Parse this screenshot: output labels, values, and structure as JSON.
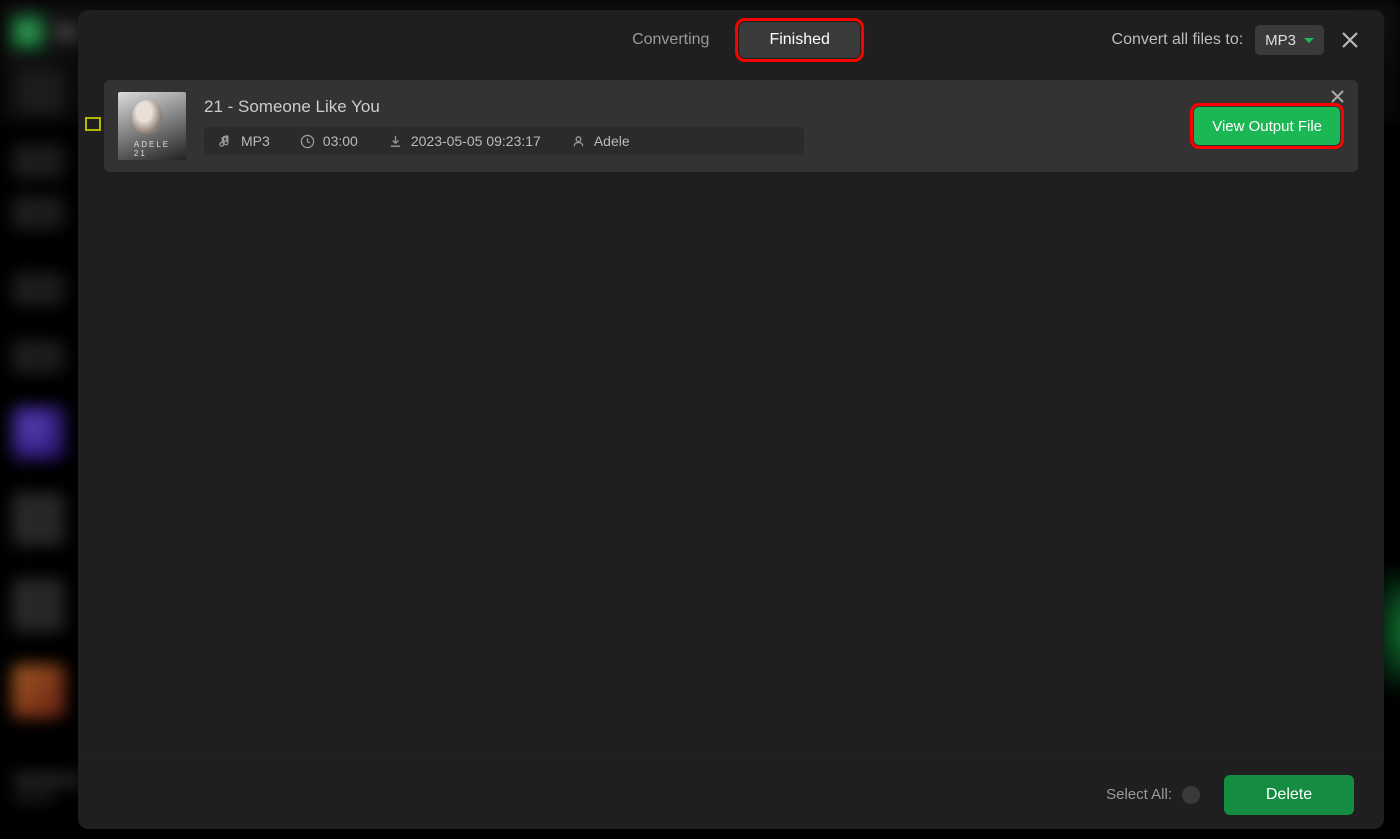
{
  "background": {
    "app_title": "Sp",
    "close_glyph": "✕"
  },
  "modal": {
    "tabs": {
      "converting": "Converting",
      "finished": "Finished"
    },
    "convert_all_label": "Convert all files to:",
    "format_selected": "MP3"
  },
  "tracks": [
    {
      "title": "21 - Someone Like You",
      "album_tag": "ADELE 21",
      "format": "MP3",
      "duration": "03:00",
      "converted_at": "2023-05-05 09:23:17",
      "artist": "Adele",
      "view_label": "View Output File"
    }
  ],
  "footer": {
    "select_all_label": "Select All:",
    "delete_label": "Delete"
  }
}
